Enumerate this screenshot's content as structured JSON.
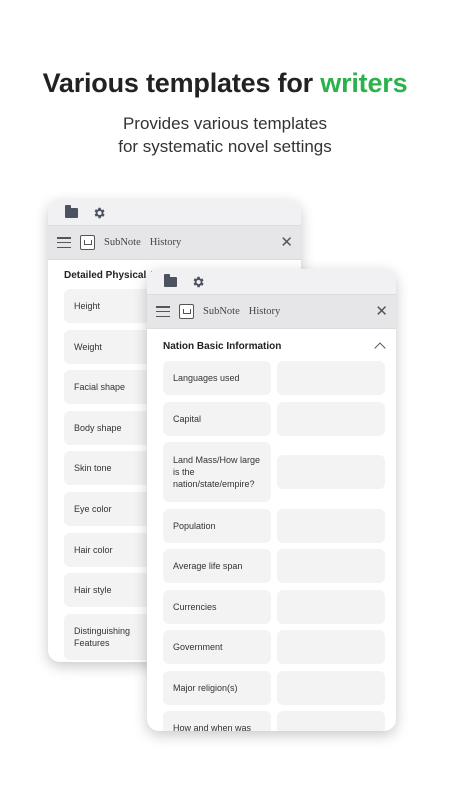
{
  "headline": {
    "prefix": "Various templates for ",
    "accent": "writers",
    "accent_color": "#2bb24c"
  },
  "subline": {
    "line1": "Provides various templates",
    "line2": "for systematic novel settings"
  },
  "back_card": {
    "tab1": "SubNote",
    "tab2": "History",
    "section_title": "Detailed Physical A",
    "fields": [
      "Height",
      "Weight",
      "Facial shape",
      "Body shape",
      "Skin tone",
      "Eye color",
      "Hair color",
      "Hair style",
      "Distinguishing Features"
    ]
  },
  "front_card": {
    "tab1": "SubNote",
    "tab2": "History",
    "section_title": "Nation Basic Information",
    "fields": [
      "Languages used",
      "Capital",
      "Land Mass/How large is the nation/state/empire?",
      "Population",
      "Average life span",
      "Currencies",
      "Government",
      "Major religion(s)",
      "How and when was"
    ],
    "values": [
      "",
      "",
      "",
      "",
      "",
      "",
      "",
      "",
      ""
    ]
  },
  "icons": [
    "folder-icon",
    "gear-icon",
    "menu-icon",
    "note-icon",
    "close-icon",
    "chevron-up-icon"
  ]
}
